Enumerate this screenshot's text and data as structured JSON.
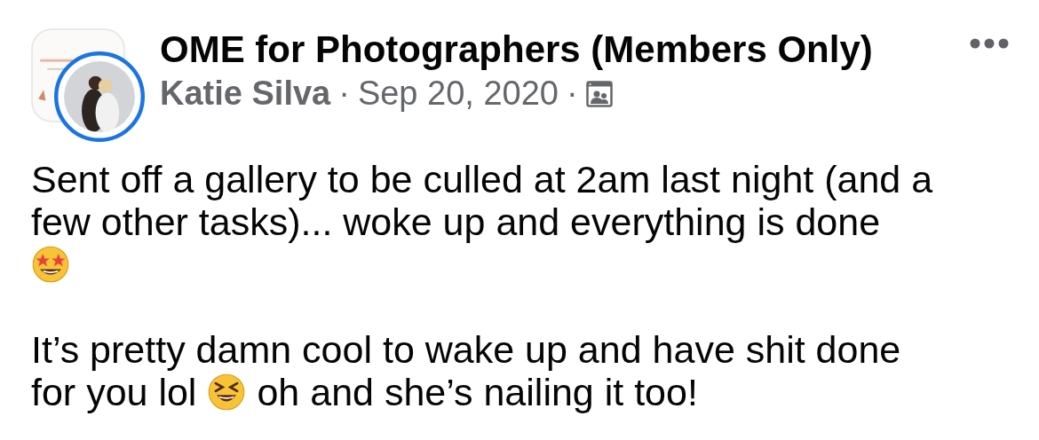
{
  "post": {
    "group": "OME for Photographers (Members Only)",
    "author": "Katie Silva",
    "separator_1": "·",
    "date": "Sep 20, 2020",
    "separator_2": "·",
    "paragraphs": [
      {
        "lines": [
          {
            "segments": [
              {
                "kind": "text",
                "text": "Sent off a gallery to be culled at 2am last night (and a"
              }
            ]
          },
          {
            "segments": [
              {
                "kind": "text",
                "text": "few other tasks)... woke up and everything is done"
              }
            ]
          },
          {
            "segments": [
              {
                "kind": "starstruck"
              }
            ]
          }
        ]
      },
      {
        "lines": [
          {
            "segments": [
              {
                "kind": "text",
                "text": "It’s pretty damn cool to wake up and have shit done"
              }
            ]
          },
          {
            "segments": [
              {
                "kind": "text",
                "text": "for you lol"
              },
              {
                "kind": "laughing"
              },
              {
                "kind": "text",
                "text": "oh and she’s nailing it too!"
              }
            ]
          }
        ]
      }
    ]
  }
}
